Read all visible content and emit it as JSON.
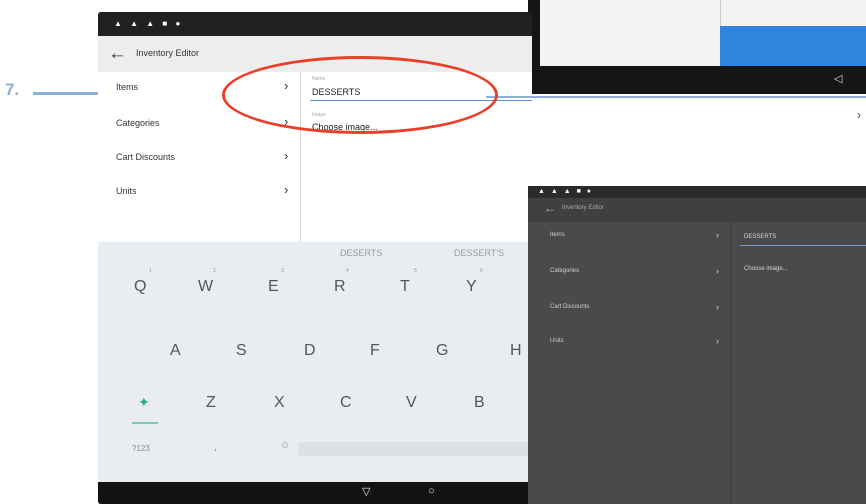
{
  "annotation": {
    "step": "7."
  },
  "screen_main": {
    "status_icons": "▲ ▲ ▲ ■ ●",
    "title": "Inventory Editor",
    "menu": [
      {
        "label": "Items"
      },
      {
        "label": "Categories"
      },
      {
        "label": "Cart Discounts"
      },
      {
        "label": "Units"
      }
    ],
    "fields": {
      "name_caption": "Name",
      "name_value": "DESSERTS",
      "image_caption": "Image",
      "image_value": "Choose image..."
    },
    "keyboard": {
      "suggestions": [
        "DESERTS",
        "DESSERT'S"
      ],
      "row1": [
        "Q",
        "W",
        "E",
        "R",
        "T",
        "Y"
      ],
      "row1_numbers": [
        "1",
        "2",
        "3",
        "4",
        "5",
        "6"
      ],
      "row2": [
        "A",
        "S",
        "D",
        "F",
        "G",
        "H"
      ],
      "row3": [
        "Z",
        "X",
        "C",
        "V",
        "B"
      ],
      "symbols_key": "?123",
      "comma_key": ",",
      "emoji_key": "☺"
    },
    "nav": {
      "back": "▽",
      "home": "○"
    }
  },
  "screen_topright": {
    "nav_back": "◁"
  },
  "screen_bottomright": {
    "status_icons": "▲ ▲ ▲ ■ ●",
    "title": "Inventory Editor",
    "menu": [
      {
        "label": "Items"
      },
      {
        "label": "Categories"
      },
      {
        "label": "Cart Discounts"
      },
      {
        "label": "Units"
      }
    ],
    "fields": {
      "name_value": "DESSERTS",
      "image_value": "Choose image..."
    }
  },
  "icons": {
    "back": "arrow-left-icon",
    "chevron": "chevron-right-icon",
    "shift": "shift-icon",
    "emoji": "emoji-icon"
  },
  "colors": {
    "annotation_arrow": "#8fb0d6",
    "annotation_circle": "#e8402a",
    "accent_blue": "#2f84dd",
    "shift_accent": "#2eaa8a"
  }
}
